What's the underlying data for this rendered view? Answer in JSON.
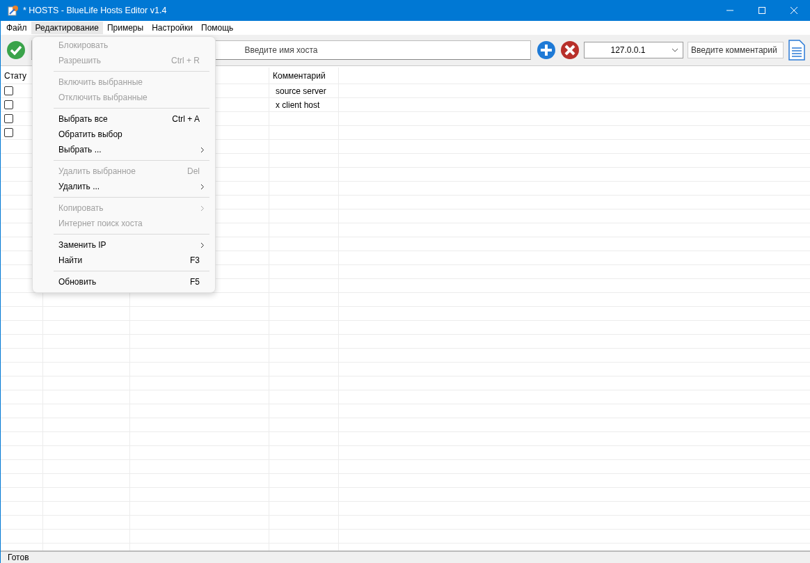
{
  "window": {
    "title": "* HOSTS - BlueLife Hosts Editor v1.4"
  },
  "menu_bar": [
    {
      "label": "Файл",
      "selected": false
    },
    {
      "label": "Редактирование",
      "selected": true
    },
    {
      "label": "Примеры",
      "selected": false
    },
    {
      "label": "Настройки",
      "selected": false
    },
    {
      "label": "Помощь",
      "selected": false
    }
  ],
  "toolbar": {
    "host_field": {
      "placeholder": "Введите имя хоста"
    },
    "ip_combo": {
      "value": "127.0.0.1"
    },
    "comment_field": {
      "placeholder": "Введите комментарий"
    }
  },
  "table": {
    "columns": {
      "status": "Стату",
      "comment": "Комментарий"
    },
    "rows": [
      {
        "checked": false,
        "comment": "source server"
      },
      {
        "checked": false,
        "comment": "x client host"
      },
      {
        "checked": false
      },
      {
        "checked": false
      }
    ]
  },
  "dropdown_menu": [
    {
      "kind": "item",
      "label": "Блокировать",
      "disabled": true
    },
    {
      "kind": "item",
      "label": "Разрешить",
      "shortcut": "Ctrl + R",
      "disabled": true
    },
    {
      "kind": "separator"
    },
    {
      "kind": "item",
      "label": "Включить выбранные",
      "disabled": true
    },
    {
      "kind": "item",
      "label": "Отключить выбранные",
      "disabled": true
    },
    {
      "kind": "separator"
    },
    {
      "kind": "item",
      "label": "Выбрать все",
      "shortcut": "Ctrl + A",
      "disabled": false
    },
    {
      "kind": "item",
      "label": "Обратить выбор",
      "disabled": false
    },
    {
      "kind": "submenu",
      "label": "Выбрать ...",
      "disabled": false
    },
    {
      "kind": "separator"
    },
    {
      "kind": "item",
      "label": "Удалить выбранное",
      "shortcut": "Del",
      "disabled": true
    },
    {
      "kind": "submenu",
      "label": "Удалить ...",
      "disabled": false
    },
    {
      "kind": "separator"
    },
    {
      "kind": "submenu",
      "label": "Копировать",
      "disabled": true
    },
    {
      "kind": "item",
      "label": "Интернет поиск хоста",
      "disabled": true
    },
    {
      "kind": "separator"
    },
    {
      "kind": "submenu",
      "label": "Заменить IP",
      "disabled": false
    },
    {
      "kind": "item",
      "label": "Найти",
      "shortcut": "F3",
      "disabled": false
    },
    {
      "kind": "separator"
    },
    {
      "kind": "item",
      "label": "Обновить",
      "shortcut": "F5",
      "disabled": false
    }
  ],
  "status_bar": {
    "text": "Готов"
  }
}
